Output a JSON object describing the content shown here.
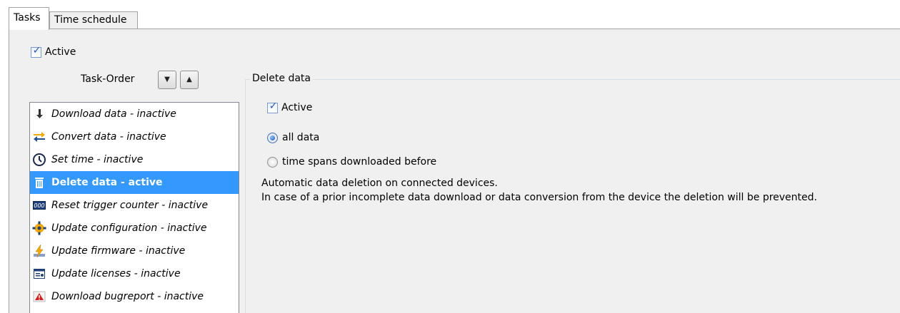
{
  "tabs": [
    {
      "label": "Tasks",
      "active": true
    },
    {
      "label": "Time schedule",
      "active": false
    }
  ],
  "active_checkbox": {
    "label": "Active",
    "checked": true
  },
  "task_order": {
    "label": "Task-Order",
    "down_icon": "triangle-down-icon",
    "up_icon": "triangle-up-icon"
  },
  "tasks": [
    {
      "label": "Download data - inactive",
      "icon": "download-icon",
      "selected": false
    },
    {
      "label": "Convert data - inactive",
      "icon": "convert-arrows-icon",
      "selected": false
    },
    {
      "label": "Set time - inactive",
      "icon": "clock-icon",
      "selected": false
    },
    {
      "label": "Delete data - active",
      "icon": "trash-icon",
      "selected": true
    },
    {
      "label": "Reset trigger counter - inactive",
      "icon": "counter-icon",
      "selected": false
    },
    {
      "label": "Update configuration - inactive",
      "icon": "gear-icon",
      "selected": false
    },
    {
      "label": "Update firmware - inactive",
      "icon": "lightning-icon",
      "selected": false
    },
    {
      "label": "Update licenses - inactive",
      "icon": "license-icon",
      "selected": false
    },
    {
      "label": "Download bugreport - inactive",
      "icon": "bugreport-icon",
      "selected": false
    }
  ],
  "detail": {
    "group_title": "Delete data",
    "active": {
      "label": "Active",
      "checked": true
    },
    "options": [
      {
        "label": "all data",
        "checked": true
      },
      {
        "label": "time spans downloaded before",
        "checked": false
      }
    ],
    "description_line1": "Automatic data deletion on connected devices.",
    "description_line2": "In case of a prior incomplete data download or data conversion from the device the deletion will be prevented."
  },
  "colors": {
    "selection": "#3399ff",
    "panel": "#f0f0f0",
    "check": "#2c55b5"
  }
}
